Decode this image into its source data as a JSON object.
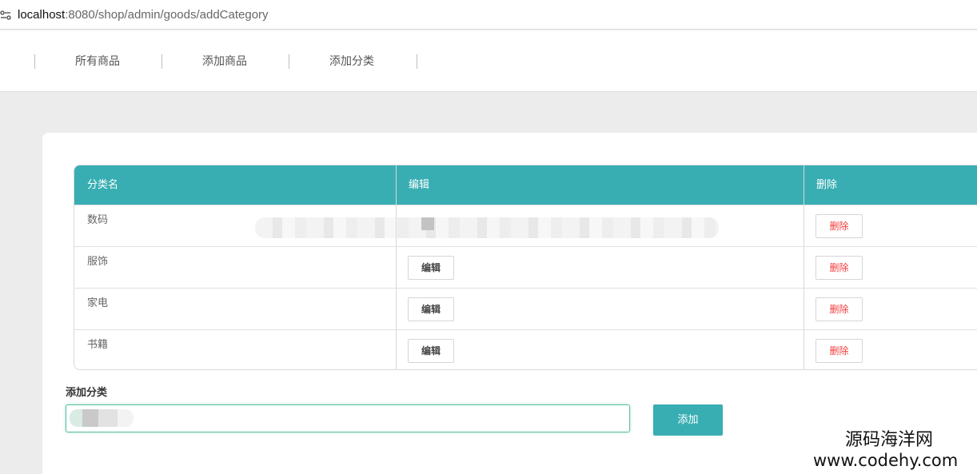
{
  "browser": {
    "url_host": "localhost",
    "url_rest": ":8080/shop/admin/goods/addCategory",
    "site_icon": "site-settings-icon"
  },
  "nav": {
    "items": [
      "所有商品",
      "添加商品",
      "添加分类"
    ]
  },
  "table": {
    "headers": [
      "分类名",
      "编辑",
      "删除"
    ],
    "rows": [
      {
        "name": "数码",
        "edit": "",
        "delete": "删除"
      },
      {
        "name": "服饰",
        "edit": "编辑",
        "delete": "删除"
      },
      {
        "name": "家电",
        "edit": "编辑",
        "delete": "删除"
      },
      {
        "name": "书籍",
        "edit": "编辑",
        "delete": "删除"
      }
    ]
  },
  "form": {
    "label": "添加分类",
    "input_value": "",
    "add_button": "添加"
  },
  "watermark": {
    "cn": "源码海洋网",
    "en": "www.codehy.com"
  },
  "colors": {
    "accent": "#38aeb3",
    "delete": "#f23c3c",
    "input_focus": "#5fc0a3"
  }
}
